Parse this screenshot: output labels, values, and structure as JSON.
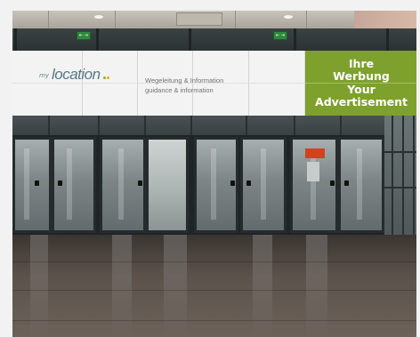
{
  "scene": {
    "exit_sign_glyph": "⇤ ⇥"
  },
  "banner": {
    "logo_prefix": "my",
    "logo_main": "location",
    "info_line1": "Wegeleitung & Information",
    "info_line2": "guidance & information",
    "ad_line1": "Ihre",
    "ad_line2": "Werbung",
    "ad_line3": "Your",
    "ad_line4": "Advertisement"
  },
  "colors": {
    "ad_green": "#7ea02d",
    "logo_blue": "#5a7888",
    "logo_dot_green": "#8ab52e",
    "logo_dot_orange": "#e8a91b",
    "exit_green": "#2f8a3e",
    "red_sign": "#d6401f"
  }
}
